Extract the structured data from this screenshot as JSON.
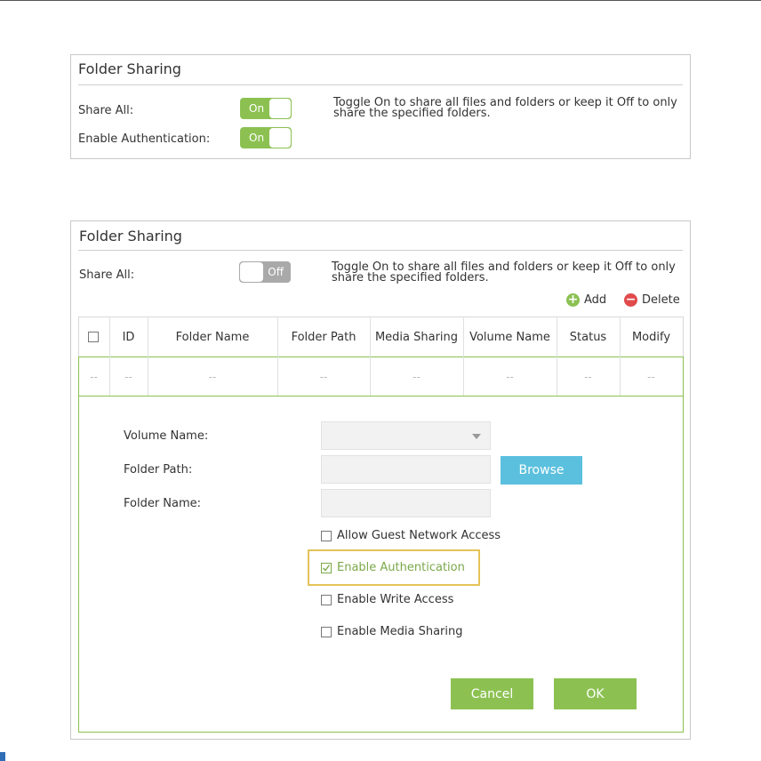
{
  "top": {
    "title": "Folder Sharing",
    "share_all_label": "Share All:",
    "share_all_state": "On",
    "enable_auth_label": "Enable Authentication:",
    "enable_auth_state": "On",
    "description_line1": "Toggle On to share all files and folders or keep it Off to only",
    "description_line2": "share the specified folders."
  },
  "bottom": {
    "title": "Folder Sharing",
    "share_all_label": "Share All:",
    "share_all_state": "Off",
    "description_line1": "Toggle On to share all files and folders or keep it Off to only",
    "description_line2": "share the specified folders.",
    "add_label": "Add",
    "delete_label": "Delete",
    "table": {
      "headers": [
        "ID",
        "Folder Name",
        "Folder Path",
        "Media Sharing",
        "Volume Name",
        "Status",
        "Modify"
      ],
      "row": [
        "--",
        "--",
        "--",
        "--",
        "--",
        "--",
        "--",
        "--"
      ]
    },
    "form": {
      "volume_label": "Volume Name:",
      "path_label": "Folder Path:",
      "name_label": "Folder Name:",
      "browse_label": "Browse",
      "guest_label": "Allow Guest Network Access",
      "auth_label": "Enable Authentication",
      "write_label": "Enable Write Access",
      "media_label": "Enable Media Sharing",
      "cancel_label": "Cancel",
      "ok_label": "OK"
    }
  },
  "colors": {
    "accent_green": "#8cc152",
    "browse_blue": "#5bc0de",
    "delete_red": "#e04b4b",
    "highlight": "#e5c35a"
  }
}
